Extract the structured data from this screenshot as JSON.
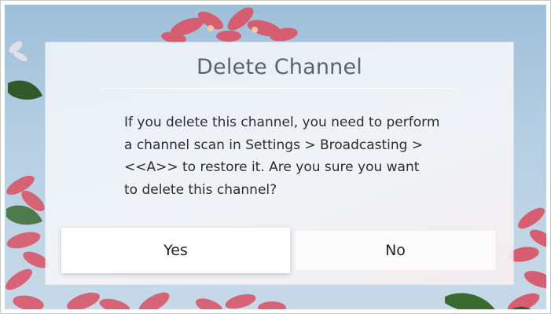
{
  "dialog": {
    "title": "Delete Channel",
    "message_lines": [
      "If you delete this channel, you need to perform",
      "a channel scan in Settings > Broadcasting >",
      "<<A>> to restore it. Are you sure you want",
      "to delete this channel?"
    ],
    "yes_label": "Yes",
    "no_label": "No"
  },
  "colors": {
    "sky": "#a9c6de",
    "flower": "#d8586a",
    "leaf": "#2f5a2a",
    "dialog_bg": "#eef3f7"
  }
}
